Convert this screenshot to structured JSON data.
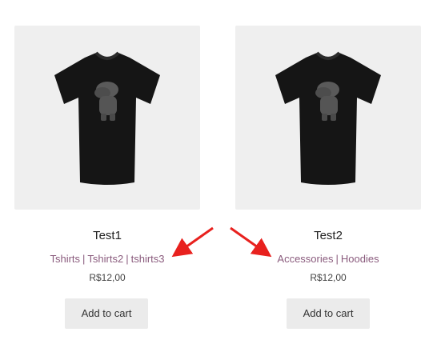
{
  "products": [
    {
      "title": "Test1",
      "categories": [
        "Tshirts",
        "Tshirts2",
        "tshirts3"
      ],
      "price": "R$12,00",
      "button_label": "Add to cart",
      "image_icon": "black-tshirt-icon"
    },
    {
      "title": "Test2",
      "categories": [
        "Accessories",
        "Hoodies"
      ],
      "price": "R$12,00",
      "button_label": "Add to cart",
      "image_icon": "black-tshirt-icon"
    }
  ],
  "separator": "|",
  "colors": {
    "category_link": "#8a5b7d",
    "annotation_arrow": "#e8211e",
    "thumb_background": "#efefef",
    "button_background": "#ebebeb"
  }
}
